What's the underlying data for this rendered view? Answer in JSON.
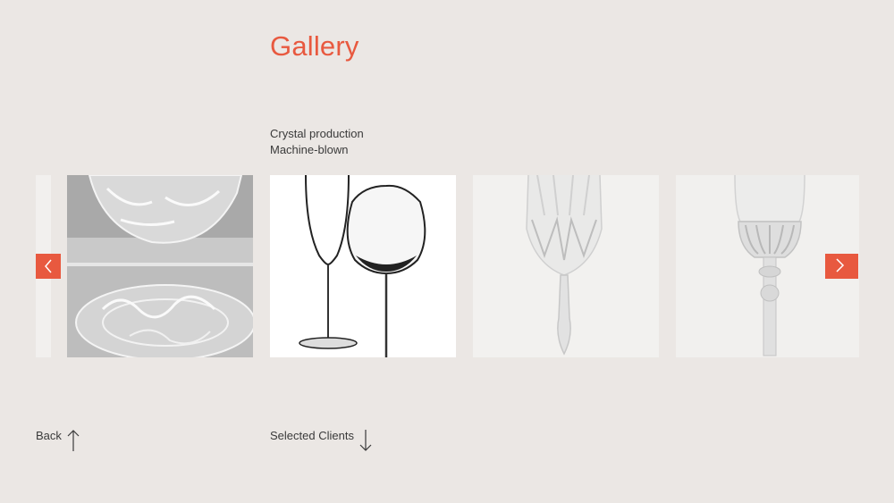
{
  "page": {
    "title": "Gallery",
    "subtitle_lines": [
      "Crystal production",
      "Machine-blown"
    ]
  },
  "carousel": {
    "prev_icon": "chevron-left-icon",
    "next_icon": "chevron-right-icon",
    "slides": [
      {
        "name": "crystal-bowls-photo"
      },
      {
        "name": "wine-glasses-photo"
      },
      {
        "name": "cut-crystal-goblet-photo"
      },
      {
        "name": "crystal-champagne-flute-photo"
      }
    ]
  },
  "footer": {
    "back_label": "Back",
    "back_icon": "arrow-up-icon",
    "clients_label": "Selected Clients",
    "clients_icon": "arrow-down-icon"
  },
  "colors": {
    "background": "#ebe7e4",
    "accent": "#e8593f",
    "text": "#3a3a3a"
  }
}
